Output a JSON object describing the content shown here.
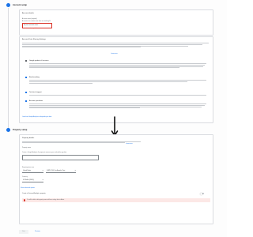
{
  "step1": {
    "title": "Account setup"
  },
  "account_details": {
    "heading": "Account details",
    "name_label": "Account name (required)",
    "name_hint": "Accounts can contain more than one tracking ID.",
    "name_value": "My new account name",
    "name_error": "Account name is required"
  },
  "sharing": {
    "heading": "Account Data Sharing Settings",
    "intro_link": "Learn more",
    "items": [
      {
        "label": "Google products & services",
        "checked": false
      },
      {
        "label": "Benchmarking",
        "checked": true
      },
      {
        "label": "Technical support",
        "checked": true
      },
      {
        "label": "Account specialists",
        "checked": true
      }
    ],
    "footer_link": "Learn how Google Analytics safeguards your data"
  },
  "step2": {
    "title": "Property setup"
  },
  "property": {
    "details_label": "Property details",
    "desc_link": "Learn more",
    "name_label": "Property name",
    "name_hint": "Create a Google Analytics 4 property to measure your web and/or app data.",
    "timezone_label": "Reporting time zone",
    "country_value": "United States",
    "timezone_value": "(GMT-07:00) Los Angeles Time",
    "currency_label": "Currency",
    "currency_value": "US Dollar (USD $)",
    "advanced_link": "Show advanced options",
    "toggle_label": "Create a Universal Analytics property",
    "notice_text": "You will be able to edit property name and these settings later in Admin."
  },
  "buttons": {
    "next": "Next",
    "previous": "Previous"
  },
  "colors": {
    "accent": "#1a73e8",
    "error": "#d93025",
    "arrow": "#111111"
  },
  "icons": {
    "arrow": "down-arrow-icon",
    "checkbox": "checkbox-icon"
  }
}
